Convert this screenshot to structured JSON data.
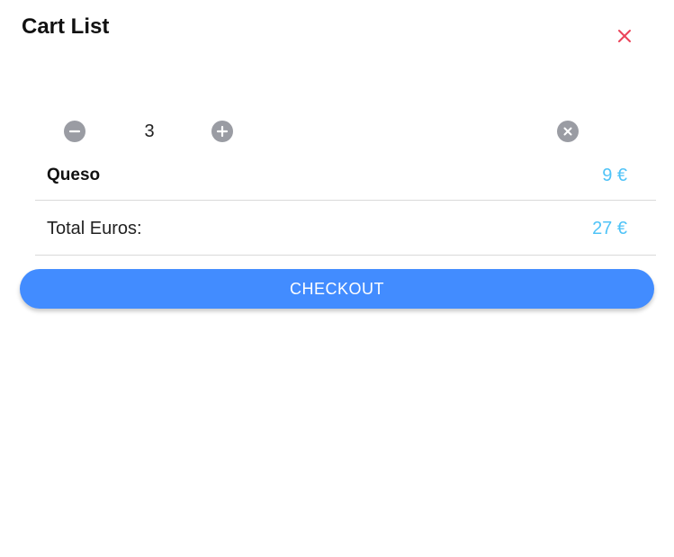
{
  "header": {
    "title": "Cart List",
    "close_icon": "close-icon"
  },
  "cart": {
    "items": [
      {
        "quantity": "3",
        "name": "Queso",
        "price": "9 €"
      }
    ],
    "total_label": "Total Euros:",
    "total_value": "27 €"
  },
  "actions": {
    "checkout_label": "CHECKOUT"
  },
  "colors": {
    "accent": "#428cff",
    "price": "#4fc3f7",
    "close": "#eb445a",
    "icon_gray": "#9a9ca3"
  }
}
